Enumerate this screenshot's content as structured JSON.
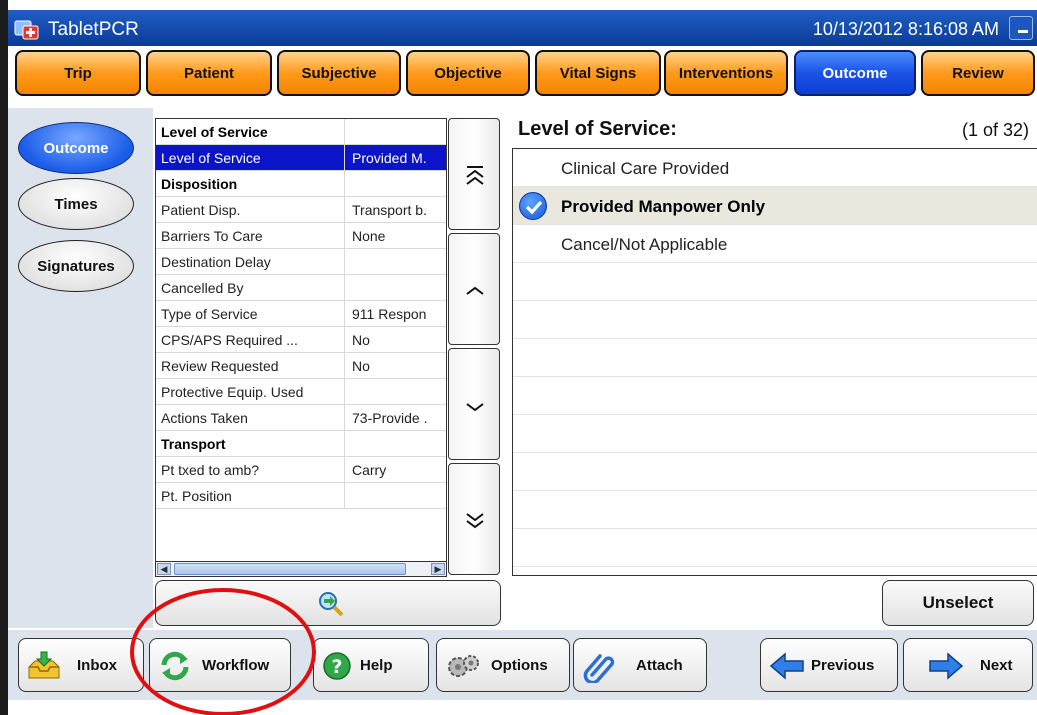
{
  "app": {
    "title": "TabletPCR",
    "datetime": "10/13/2012 8:16:08 AM"
  },
  "tabs": [
    {
      "label": "Trip",
      "active": false
    },
    {
      "label": "Patient",
      "active": false
    },
    {
      "label": "Subjective",
      "active": false
    },
    {
      "label": "Objective",
      "active": false
    },
    {
      "label": "Vital Signs",
      "active": false
    },
    {
      "label": "Interventions",
      "active": false
    },
    {
      "label": "Outcome",
      "active": true
    },
    {
      "label": "Review",
      "active": false
    }
  ],
  "sidenav": [
    {
      "label": "Outcome",
      "active": true
    },
    {
      "label": "Times",
      "active": false
    },
    {
      "label": "Signatures",
      "active": false
    }
  ],
  "grid": {
    "rows": [
      {
        "label": "Level of Service",
        "value": "",
        "type": "header"
      },
      {
        "label": "Level of Service",
        "value": "Provided M.",
        "type": "selected"
      },
      {
        "label": "Disposition",
        "value": "",
        "type": "header"
      },
      {
        "label": "Patient Disp.",
        "value": "Transport b.",
        "type": "row"
      },
      {
        "label": "Barriers To Care",
        "value": "None",
        "type": "row"
      },
      {
        "label": "Destination Delay",
        "value": "",
        "type": "row"
      },
      {
        "label": "Cancelled By",
        "value": "",
        "type": "row"
      },
      {
        "label": "Type of Service",
        "value": "911 Respon",
        "type": "row"
      },
      {
        "label": "CPS/APS Required ...",
        "value": "No",
        "type": "row"
      },
      {
        "label": "Review Requested",
        "value": "No",
        "type": "row"
      },
      {
        "label": "Protective Equip. Used",
        "value": "",
        "type": "row"
      },
      {
        "label": "Actions Taken",
        "value": "73-Provide .",
        "type": "row"
      },
      {
        "label": "Transport",
        "value": "",
        "type": "header"
      },
      {
        "label": "Pt txed to amb?",
        "value": "Carry",
        "type": "row"
      },
      {
        "label": "Pt. Position",
        "value": "",
        "type": "row"
      }
    ],
    "scrollbar_thumb_fraction": 0.8
  },
  "detail": {
    "title": "Level of Service:",
    "counter": "(1 of 32)",
    "options": [
      {
        "label": "Clinical Care Provided",
        "selected": false
      },
      {
        "label": "Provided Manpower Only",
        "selected": true
      },
      {
        "label": "Cancel/Not Applicable",
        "selected": false
      }
    ]
  },
  "actions": {
    "unselect_label": "Unselect"
  },
  "toolbar": {
    "inbox": "Inbox",
    "workflow": "Workflow",
    "help": "Help",
    "options": "Options",
    "attach": "Attach",
    "previous": "Previous",
    "next": "Next"
  },
  "colors": {
    "tab_orange": "#ff9a1c",
    "tab_active_blue": "#1853e6",
    "selection_blue": "#0b14c8",
    "annotation_red": "#e01010"
  },
  "icons": {
    "app": "tabletpcr-app-icon",
    "check": "check-circle-icon",
    "go": "magnifier-arrow-icon"
  }
}
